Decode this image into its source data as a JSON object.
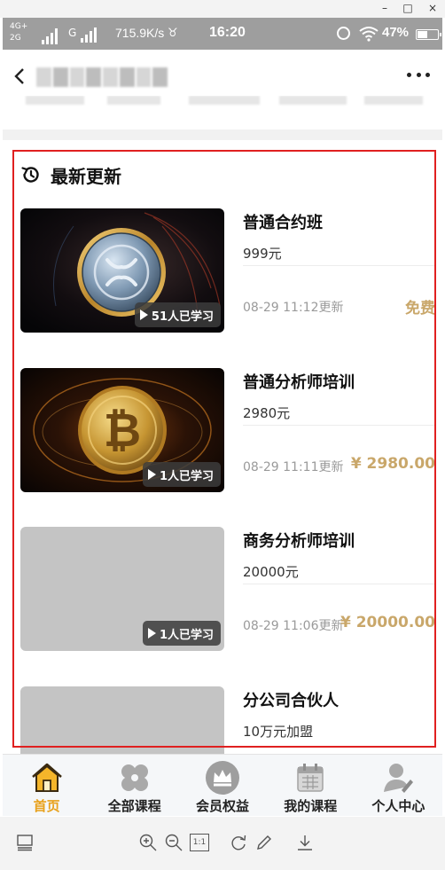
{
  "window": {
    "minimize": "–",
    "maximize": "□",
    "close": "×"
  },
  "status_bar": {
    "network_top": "4G+",
    "network_bottom": "2G",
    "g_label": "G",
    "speed": "715.9K/s",
    "time": "16:20",
    "battery": "47%",
    "battery_level": 0.47
  },
  "section": {
    "title": "最新更新",
    "icon": "history-icon"
  },
  "courses": [
    {
      "title": "普通合约班",
      "price": "999元",
      "updated": "08-29 11:12更新",
      "tag": "免费",
      "learners": "51人已学习",
      "thumbnail": "xrp-coin-icon"
    },
    {
      "title": "普通分析师培训",
      "price": "2980元",
      "updated": "08-29 11:11更新",
      "tag": "¥ 2980.00",
      "learners": "1人已学习",
      "thumbnail": "bitcoin-icon"
    },
    {
      "title": "商务分析师培训",
      "price": "20000元",
      "updated": "08-29 11:06更新",
      "tag": "¥ 20000.00",
      "learners": "1人已学习",
      "thumbnail": "placeholder"
    },
    {
      "title": "分公司合伙人",
      "price": "10万元加盟",
      "updated": "",
      "tag": "",
      "learners": "",
      "thumbnail": "placeholder"
    }
  ],
  "tabs": [
    {
      "label": "首页",
      "icon": "home-icon",
      "active": true
    },
    {
      "label": "全部课程",
      "icon": "clover-icon",
      "active": false
    },
    {
      "label": "会员权益",
      "icon": "crown-icon",
      "active": false
    },
    {
      "label": "我的课程",
      "icon": "calendar-icon",
      "active": false
    },
    {
      "label": "个人中心",
      "icon": "user-icon",
      "active": false
    }
  ],
  "viewer_toolbar": {
    "actual_size_label": "1:1"
  },
  "colors": {
    "accent_gold": "#c9a76a",
    "active_tab": "#e8a11c",
    "selection_outline": "#e02020"
  }
}
